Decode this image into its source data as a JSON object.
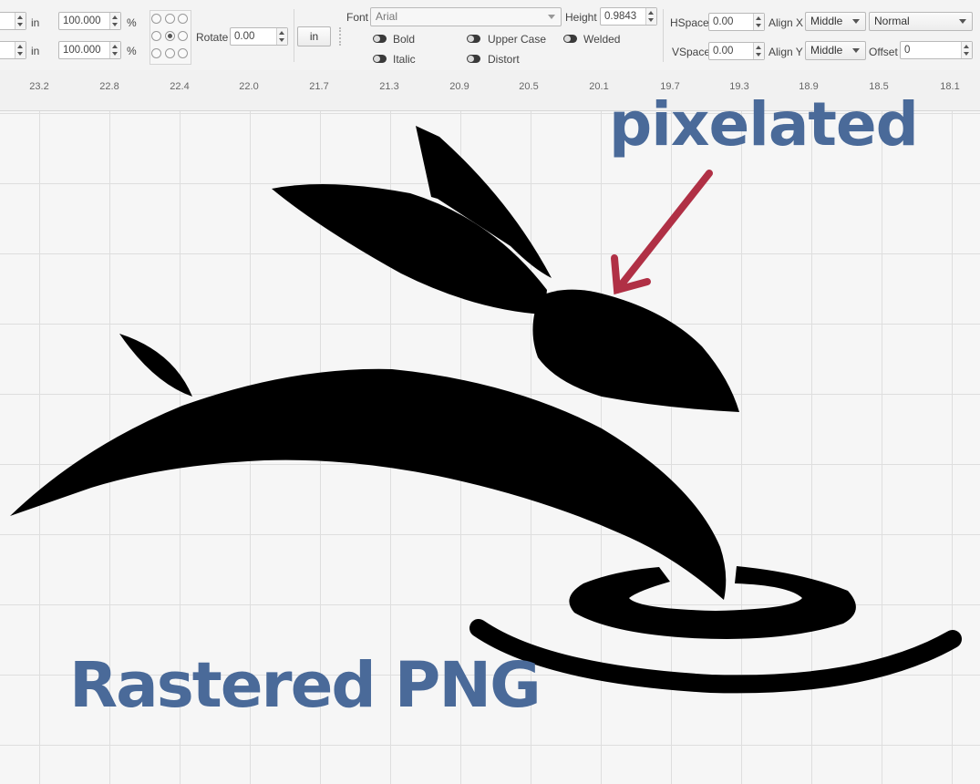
{
  "toolbar": {
    "row1": {
      "unit": "in",
      "scale": "100.000",
      "percent": "%"
    },
    "row2": {
      "unit": "in",
      "scale": "100.000",
      "percent": "%"
    },
    "rotate": {
      "label": "Rotate",
      "value": "0.00",
      "unit_button": "in"
    },
    "font": {
      "label": "Font",
      "value": "Arial",
      "height_label": "Height",
      "height_value": "0.9843"
    },
    "toggles": {
      "bold": "Bold",
      "italic": "Italic",
      "upper_case": "Upper Case",
      "distort": "Distort",
      "welded": "Welded"
    },
    "spacing": {
      "hspace_label": "HSpace",
      "hspace_value": "0.00",
      "vspace_label": "VSpace",
      "vspace_value": "0.00"
    },
    "align": {
      "x_label": "Align X",
      "x_value": "Middle",
      "y_label": "Align Y",
      "y_value": "Middle"
    },
    "mode": {
      "value": "Normal"
    },
    "offset": {
      "label": "Offset",
      "value": "0"
    }
  },
  "ruler": {
    "ticks": [
      "23.2",
      "22.8",
      "22.4",
      "22.0",
      "21.7",
      "21.3",
      "20.9",
      "20.5",
      "20.1",
      "19.7",
      "19.3",
      "18.9",
      "18.5",
      "18.1"
    ]
  },
  "annotations": {
    "pixelated": "pixelated",
    "rastered": "Rastered PNG",
    "text_color": "#4a6a99",
    "arrow_color": "#b03045"
  }
}
